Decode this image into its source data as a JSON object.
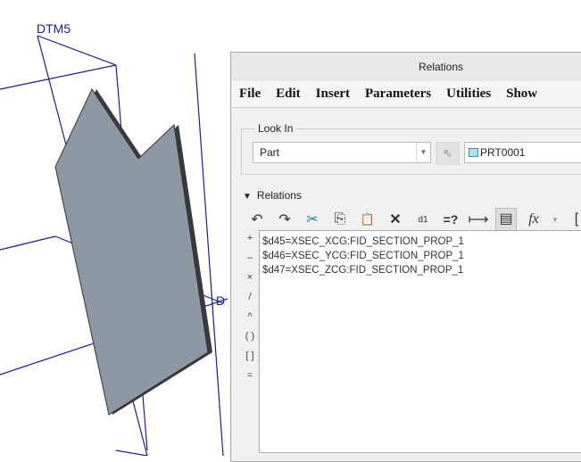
{
  "viewport": {
    "datum_labels": [
      "DTM5",
      "D"
    ],
    "plane_color": "#1a1aa0",
    "part_color": "#8e98a4"
  },
  "dialog": {
    "title": "Relations",
    "menu": [
      "File",
      "Edit",
      "Insert",
      "Parameters",
      "Utilities",
      "Show"
    ],
    "look_in": {
      "label": "Look In",
      "type_value": "Part",
      "model_value": "PRT0001"
    },
    "relations_header": "Relations",
    "toolbar": {
      "undo": "↶",
      "redo": "↷",
      "cut": "✂",
      "copy": "⎘",
      "paste": "📋",
      "delete": "✕",
      "dims": "d1",
      "verify": "=?",
      "dim_toggle": "⟼",
      "sort": "▤",
      "fx": "fx",
      "bracket": "["
    },
    "operators": [
      "+",
      "–",
      "×",
      "/",
      "^",
      "( )",
      "[ ]",
      "="
    ],
    "relations": [
      "$d45=XSEC_XCG:FID_SECTION_PROP_1",
      "$d46=XSEC_YCG:FID_SECTION_PROP_1",
      "$d47=XSEC_ZCG:FID_SECTION_PROP_1"
    ]
  }
}
